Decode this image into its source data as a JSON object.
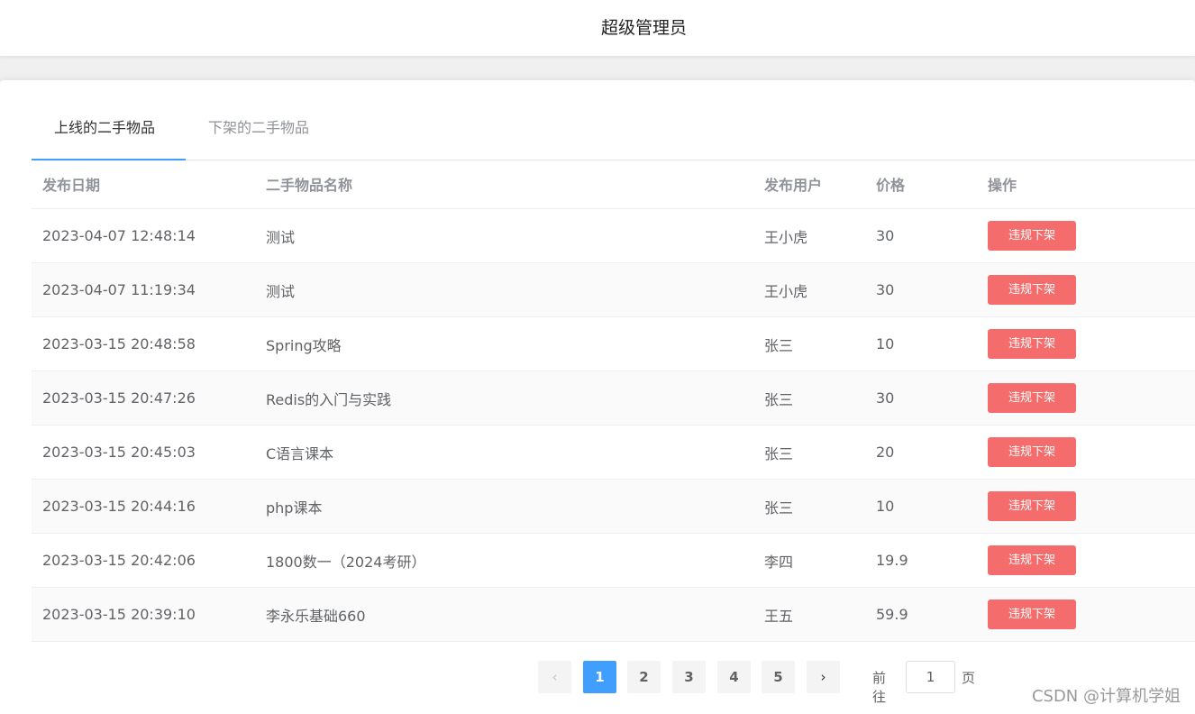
{
  "header": {
    "title": "超级管理员"
  },
  "tabs": [
    {
      "label": "上线的二手物品"
    },
    {
      "label": "下架的二手物品"
    }
  ],
  "table": {
    "columns": [
      "发布日期",
      "二手物品名称",
      "发布用户",
      "价格",
      "操作"
    ],
    "action_label": "违规下架",
    "rows": [
      {
        "date": "2023-04-07 12:48:14",
        "name": "测试",
        "user": "王小虎",
        "price": "30"
      },
      {
        "date": "2023-04-07 11:19:34",
        "name": "测试",
        "user": "王小虎",
        "price": "30"
      },
      {
        "date": "2023-03-15 20:48:58",
        "name": "Spring攻略",
        "user": "张三",
        "price": "10"
      },
      {
        "date": "2023-03-15 20:47:26",
        "name": "Redis的入门与实践",
        "user": "张三",
        "price": "30"
      },
      {
        "date": "2023-03-15 20:45:03",
        "name": "C语言课本",
        "user": "张三",
        "price": "20"
      },
      {
        "date": "2023-03-15 20:44:16",
        "name": "php课本",
        "user": "张三",
        "price": "10"
      },
      {
        "date": "2023-03-15 20:42:06",
        "name": "1800数一（2024考研）",
        "user": "李四",
        "price": "19.9"
      },
      {
        "date": "2023-03-15 20:39:10",
        "name": "李永乐基础660",
        "user": "王五",
        "price": "59.9"
      }
    ]
  },
  "pagination": {
    "prev_icon": "‹",
    "next_icon": "›",
    "pages": [
      "1",
      "2",
      "3",
      "4",
      "5"
    ],
    "current": "1",
    "goto_label": "前往",
    "goto_value": "1",
    "page_suffix": "页"
  },
  "watermark": "CSDN @计算机学姐",
  "colors": {
    "accent": "#409eff",
    "danger": "#f56c6c"
  }
}
